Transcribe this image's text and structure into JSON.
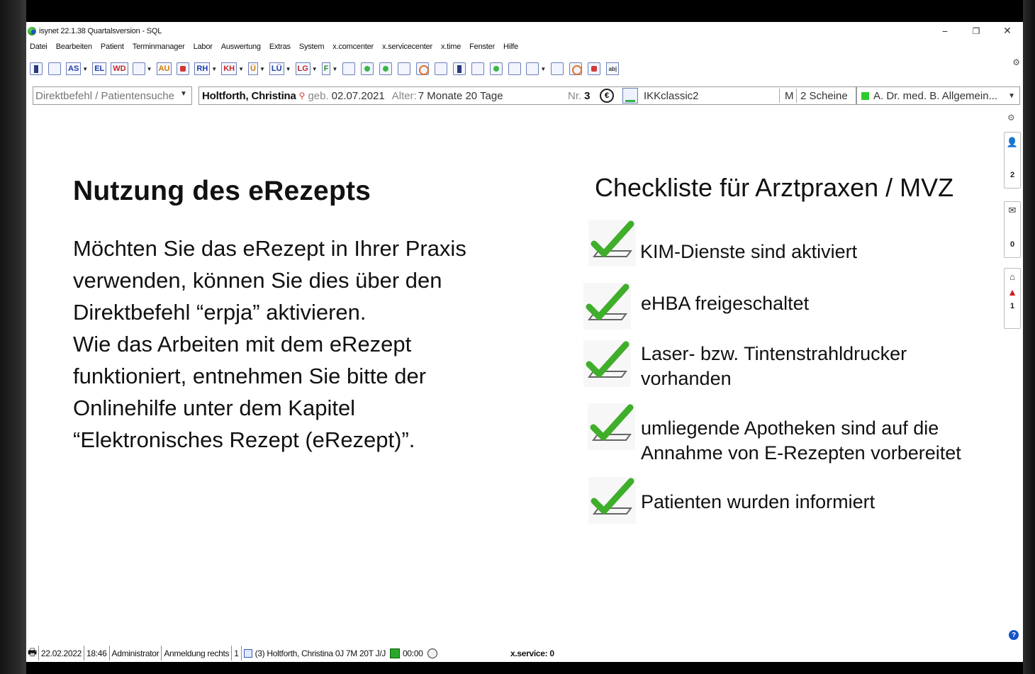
{
  "window": {
    "title": "isynet 22.1.38 Quartalsversion - SQL",
    "controls": {
      "minimize": "−",
      "restore": "❐",
      "close": "✕"
    }
  },
  "menu": [
    "Datei",
    "Bearbeiten",
    "Patient",
    "Terminmanager",
    "Labor",
    "Auswertung",
    "Extras",
    "System",
    "x.comcenter",
    "x.servicecenter",
    "x.time",
    "Fenster",
    "Hilfe"
  ],
  "toolbar": {
    "labels": [
      "AS",
      "EL",
      "WD",
      "AU",
      "RH",
      "KH",
      "Ü",
      "LÜ",
      "LG",
      "F",
      "ab|"
    ]
  },
  "patient_bar": {
    "command_placeholder": "Direktbefehl / Patientensuche",
    "name": "Holtforth, Christina",
    "birth_label": "geb.",
    "birth_date": "02.07.2021",
    "age_label": "Alter:",
    "age_value": "7 Monate 20 Tage",
    "nr_label": "Nr.",
    "nr_value": "3",
    "euro": "€",
    "insurance": "IKKclassic2",
    "gender": "M",
    "scheine": "2 Scheine",
    "doctor": "A. Dr. med. B. Allgemein..."
  },
  "side_panel": {
    "badge_persons": "2",
    "badge_messages": "0",
    "badge_warnings": "1"
  },
  "content": {
    "heading": "Nutzung des eRezepts",
    "body_lines": [
      "Möchten Sie das eRezept in Ihrer Praxis",
      "verwenden, können Sie dies über den",
      "Direktbefehl “erpja” aktivieren.",
      "Wie das Arbeiten mit dem eRezept",
      "funktioniert, entnehmen Sie bitte der",
      "Onlinehilfe unter dem Kapitel",
      "“Elektronisches Rezept (eRezept)”."
    ],
    "checklist_title": "Checkliste für Arztpraxen / MVZ",
    "checklist": [
      {
        "line1": "KIM-Dienste sind aktiviert",
        "line2": ""
      },
      {
        "line1": "eHBA freigeschaltet",
        "line2": ""
      },
      {
        "line1": "Laser- bzw. Tintenstrahldrucker",
        "line2": "vorhanden"
      },
      {
        "line1": "umliegende Apotheken sind auf die",
        "line2": "Annahme von E-Rezepten vorbereitet"
      },
      {
        "line1": "Patienten wurden informiert",
        "line2": ""
      }
    ]
  },
  "status_bar": {
    "date": "22.02.2022",
    "time": "18:46",
    "user": "Administrator",
    "login": "Anmeldung rechts",
    "count": "1",
    "patient": "(3) Holtforth, Christina 0J 7M 20T J/J",
    "timer": "00:00",
    "service": "x.service: 0"
  },
  "colors": {
    "check_green": "#3fae2a",
    "doctor_indicator": "#2dcc2d",
    "help_blue": "#1452c8"
  }
}
